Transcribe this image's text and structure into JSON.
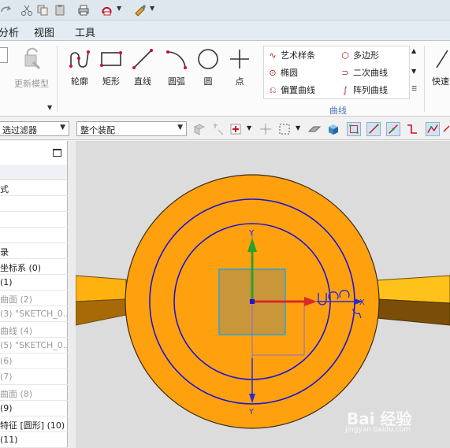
{
  "menu": {
    "items": [
      "分析",
      "视图",
      "工具"
    ]
  },
  "ribbon": {
    "update_model_label": "更新模型",
    "tools": [
      "轮廓",
      "矩形",
      "直线",
      "圆弧",
      "圆",
      "点"
    ],
    "curve_items": [
      {
        "label": "艺术样条",
        "icon": "spline-icon"
      },
      {
        "label": "多边形",
        "icon": "polygon-icon"
      },
      {
        "label": "椭圆",
        "icon": "ellipse-icon"
      },
      {
        "label": "二次曲线",
        "icon": "conic-icon"
      },
      {
        "label": "偏置曲线",
        "icon": "offset-curve-icon"
      },
      {
        "label": "阵列曲线",
        "icon": "pattern-curve-icon"
      }
    ],
    "group_label": "曲线",
    "quick_label": "快速"
  },
  "selection_bar": {
    "filter_value": "选过滤器",
    "assembly_value": "整个装配"
  },
  "navigator": {
    "rows": [
      {
        "text": "式",
        "dim": false
      },
      {
        "text": "",
        "dim": false
      },
      {
        "text": "",
        "dim": false
      },
      {
        "text": "",
        "dim": false
      },
      {
        "text": "录",
        "dim": false
      },
      {
        "text": "坐标系 (0)",
        "dim": false
      },
      {
        "text": "(1)",
        "dim": false
      },
      {
        "text": "曲面 (2)",
        "dim": true
      },
      {
        "text": "(3) \"SKETCH_0...",
        "dim": true
      },
      {
        "text": "曲线 (4)",
        "dim": true
      },
      {
        "text": "(5) \"SKETCH_0...",
        "dim": true
      },
      {
        "text": "(6)",
        "dim": true
      },
      {
        "text": "(7)",
        "dim": true
      },
      {
        "text": "曲面 (8)",
        "dim": true
      },
      {
        "text": "(9)",
        "dim": false
      },
      {
        "text": "特征 [圆形] (10)",
        "dim": false
      },
      {
        "text": "(11)",
        "dim": false
      }
    ]
  },
  "viewport": {
    "axis_y_label": "Y",
    "axis_x_label": "X"
  },
  "watermark": {
    "brand": "Bai 经验",
    "url": "jingyan.baidu.com"
  },
  "colors": {
    "part": "#ffa10f",
    "sketch": "#1c14d6",
    "outline": "#3c2c12"
  }
}
